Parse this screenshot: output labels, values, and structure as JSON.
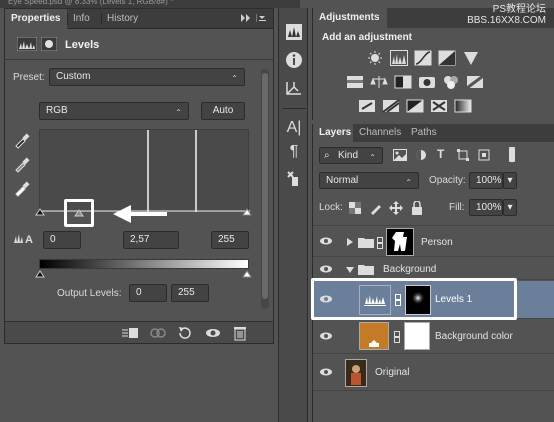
{
  "window": {
    "doc_title": "Eye Speed.psd @ 8.33% (Levels 1, RGB/8#) *",
    "watermark_line1": "PS教程论坛",
    "watermark_line2": "BBS.16XX8.COM"
  },
  "properties": {
    "tabs": [
      "Properties",
      "Info",
      "History"
    ],
    "active_tab": "Properties",
    "menu_glyph": "▸▸",
    "title": "Levels",
    "preset_label": "Preset:",
    "preset_value": "Custom",
    "channel_value": "RGB",
    "auto_label": "Auto",
    "input_levels": [
      "0",
      "2,57",
      "255"
    ],
    "output_label": "Output Levels:",
    "output_levels": [
      "0",
      "255"
    ]
  },
  "adjustments": {
    "tab": "Adjustments",
    "title": "Add an adjustment"
  },
  "layers": {
    "tabs": [
      "Layers",
      "Channels",
      "Paths"
    ],
    "active_tab": "Layers",
    "filter_value": "Kind",
    "blend_mode": "Normal",
    "opacity_label": "Opacity:",
    "opacity_value": "100%",
    "lock_label": "Lock:",
    "fill_label": "Fill:",
    "fill_value": "100%",
    "items": [
      {
        "name": "Person",
        "type": "group",
        "visible": true
      },
      {
        "name": "Background",
        "type": "group",
        "visible": true
      },
      {
        "name": "Levels 1",
        "type": "adjustment",
        "visible": true,
        "selected": true
      },
      {
        "name": "Background color",
        "type": "fill",
        "visible": true,
        "color": "#c47a27"
      },
      {
        "name": "Original",
        "type": "image",
        "visible": true
      }
    ]
  },
  "colors": {
    "panel_bg": "#535353",
    "selected_row": "#6b7f9a",
    "highlight_box": "#ffffff",
    "accent_orange": "#c47a27"
  }
}
